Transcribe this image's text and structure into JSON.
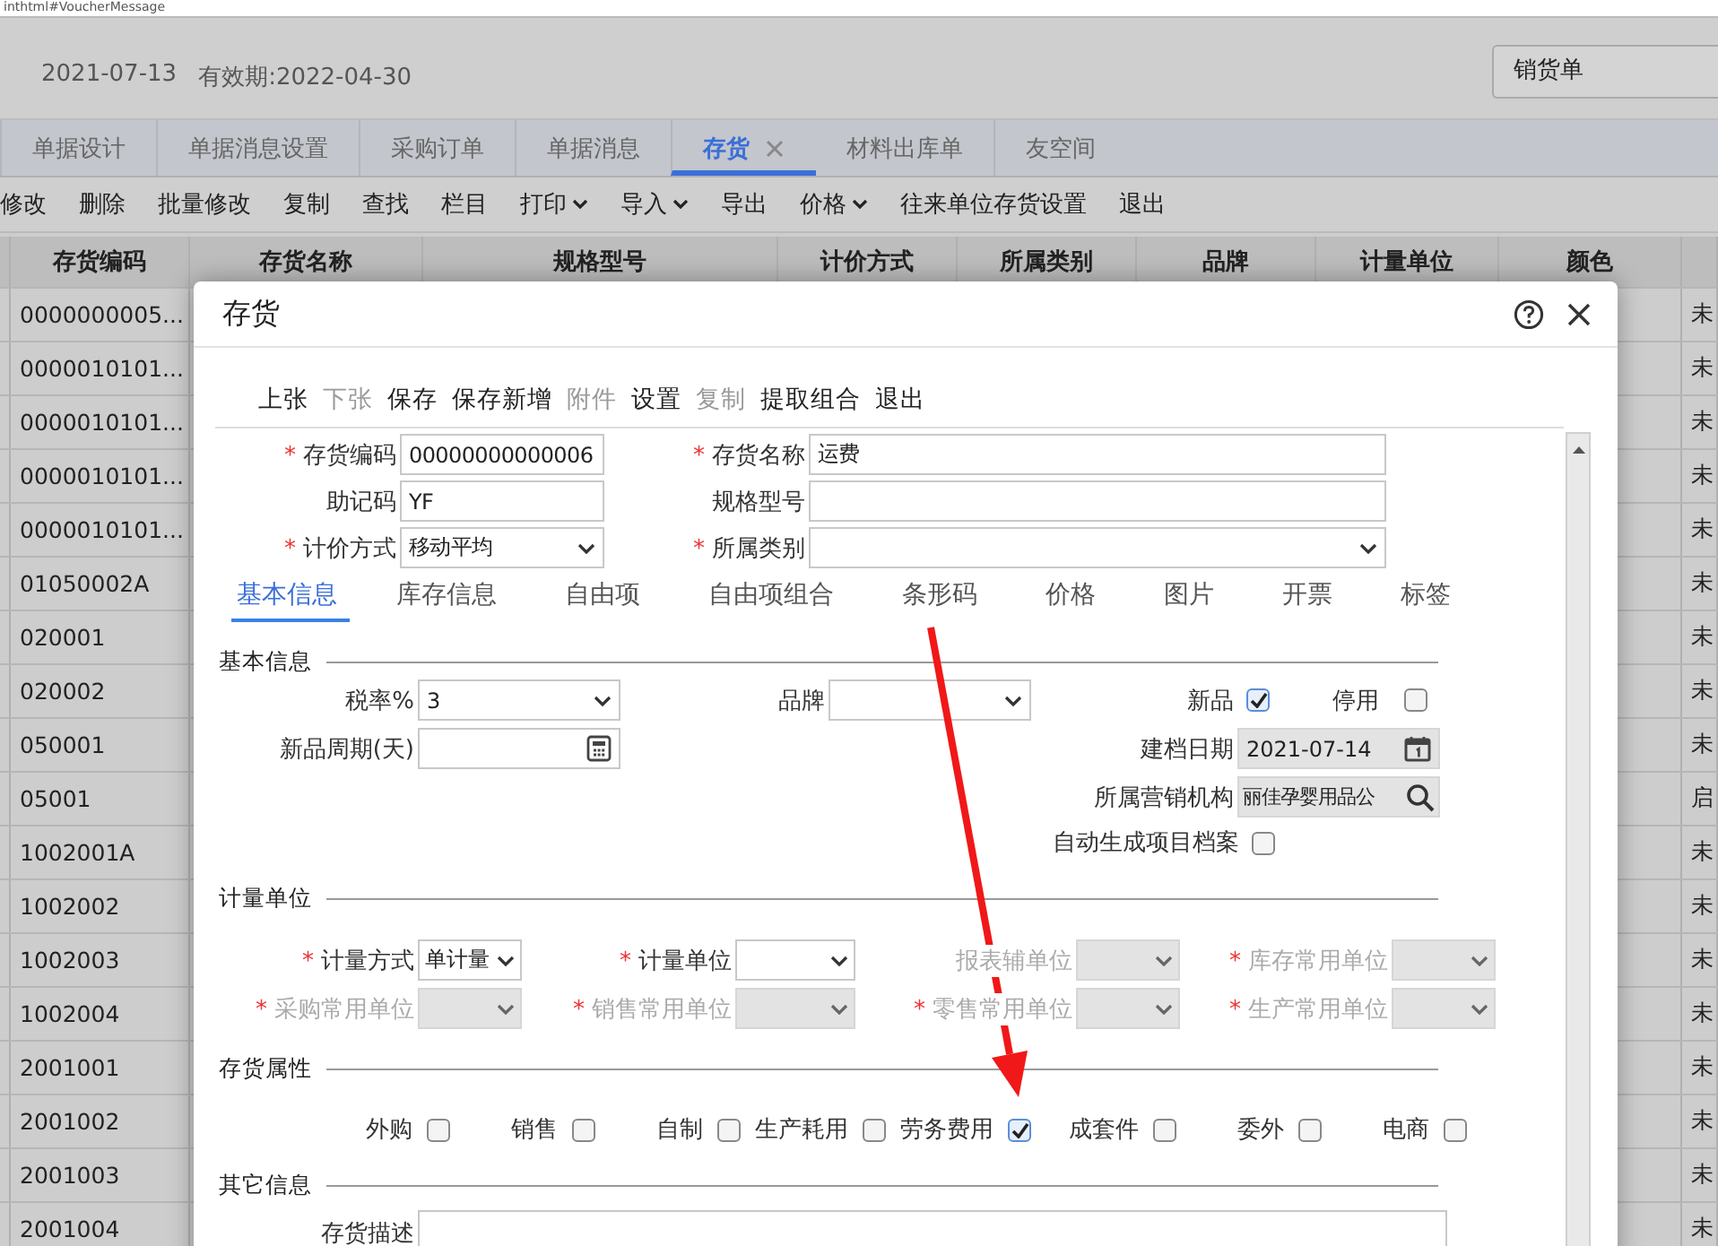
{
  "address_bar": {
    "text": "inthtml#VoucherMessage"
  },
  "header": {
    "date": "2021-07-13",
    "validity": "有效期:2022-04-30",
    "document_type": "销货单"
  },
  "tabs": [
    {
      "label": "单据设计",
      "selected": false
    },
    {
      "label": "单据消息设置",
      "selected": false
    },
    {
      "label": "采购订单",
      "selected": false
    },
    {
      "label": "单据消息",
      "selected": false
    },
    {
      "label": "存货",
      "selected": true
    },
    {
      "label": "材料出库单",
      "selected": false
    },
    {
      "label": "友空间",
      "selected": false
    }
  ],
  "toolbar": [
    {
      "label": "修改",
      "dropdown": false
    },
    {
      "label": "删除",
      "dropdown": false
    },
    {
      "label": "批量修改",
      "dropdown": false
    },
    {
      "label": "复制",
      "dropdown": false
    },
    {
      "label": "查找",
      "dropdown": false
    },
    {
      "label": "栏目",
      "dropdown": false
    },
    {
      "label": "打印",
      "dropdown": true
    },
    {
      "label": "导入",
      "dropdown": true
    },
    {
      "label": "导出",
      "dropdown": false
    },
    {
      "label": "价格",
      "dropdown": true
    },
    {
      "label": "往来单位存货设置",
      "dropdown": false
    },
    {
      "label": "退出",
      "dropdown": false
    }
  ],
  "table": {
    "columns": [
      "存货编码",
      "存货名称",
      "规格型号",
      "计价方式",
      "所属类别",
      "品牌",
      "计量单位",
      "颜色"
    ],
    "rows": [
      {
        "code": "0000000005...",
        "column_10": "未"
      },
      {
        "code": "0000010101...",
        "column_10": "未"
      },
      {
        "code": "0000010101...",
        "column_10": "未"
      },
      {
        "code": "0000010101...",
        "column_10": "未"
      },
      {
        "code": "0000010101...",
        "column_10": "未"
      },
      {
        "code": "01050002A",
        "column_10": "未"
      },
      {
        "code": "020001",
        "column_10": "未"
      },
      {
        "code": "020002",
        "column_10": "未"
      },
      {
        "code": "050001",
        "column_10": "未"
      },
      {
        "code": "05001",
        "column_10": "启"
      },
      {
        "code": "1002001A",
        "column_10": "未"
      },
      {
        "code": "1002002",
        "column_10": "未"
      },
      {
        "code": "1002003",
        "column_10": "未"
      },
      {
        "code": "1002004",
        "column_10": "未"
      },
      {
        "code": "2001001",
        "column_10": "未"
      },
      {
        "code": "2001002",
        "column_10": "未"
      },
      {
        "code": "2001003",
        "column_10": "未"
      },
      {
        "code": "2001004",
        "column_10": "未"
      }
    ]
  },
  "dialog": {
    "title": "存货",
    "toolbar": [
      {
        "label": "上张",
        "disabled": false
      },
      {
        "label": "下张",
        "disabled": true
      },
      {
        "label": "保存",
        "disabled": false
      },
      {
        "label": "保存新增",
        "disabled": false
      },
      {
        "label": "附件",
        "disabled": true
      },
      {
        "label": "设置",
        "disabled": false
      },
      {
        "label": "复制",
        "disabled": true
      },
      {
        "label": "提取组合",
        "disabled": false
      },
      {
        "label": "退出",
        "disabled": false
      }
    ],
    "header_fields": [
      {
        "label": "存货编码",
        "required_mark": "*",
        "kind": "text",
        "value": "00000000000006"
      },
      {
        "label": "存货名称",
        "required_mark": "*",
        "kind": "text",
        "value": "运费"
      },
      {
        "label": "助记码",
        "kind": "text",
        "value": "YF"
      },
      {
        "label": "规格型号",
        "kind": "text"
      },
      {
        "label": "计价方式",
        "required_mark": "*",
        "kind": "select",
        "value": "移动平均"
      },
      {
        "label": "所属类别",
        "required_mark": "*",
        "kind": "select"
      }
    ],
    "section_tabs": [
      {
        "label": "基本信息",
        "selected": true
      },
      {
        "label": "库存信息",
        "selected": false
      },
      {
        "label": "自由项",
        "selected": false
      },
      {
        "label": "自由项组合",
        "selected": false
      },
      {
        "label": "条形码",
        "selected": false
      },
      {
        "label": "价格",
        "selected": false
      },
      {
        "label": "图片",
        "selected": false
      },
      {
        "label": "开票",
        "selected": false
      },
      {
        "label": "标签",
        "selected": false
      }
    ],
    "basic_info": {
      "title": "基本信息",
      "tax_rate": {
        "label": "税率%",
        "value": "3"
      },
      "brand": {
        "label": "品牌"
      },
      "new_item": {
        "label": "新品",
        "checked": true
      },
      "inactive": {
        "label": "停用",
        "checked": false
      },
      "new_cycle": {
        "label": "新品周期(天)"
      },
      "created_date": {
        "label": "建档日期",
        "value": "2021-07-14"
      },
      "sales_org": {
        "label": "所属营销机构",
        "value": "丽佳孕婴用品公"
      },
      "auto_project": {
        "label": "自动生成项目档案",
        "checked": false
      }
    },
    "units": {
      "title": "计量单位",
      "fields": [
        {
          "label": "计量方式",
          "required_mark": "*",
          "disabled": false,
          "value": "单计量"
        },
        {
          "label": "计量单位",
          "required_mark": "*",
          "disabled": false
        },
        {
          "label": "报表辅单位",
          "disabled": true
        },
        {
          "label": "库存常用单位",
          "required_mark": "*",
          "disabled": true
        },
        {
          "label": "采购常用单位",
          "required_mark": "*",
          "disabled": true
        },
        {
          "label": "销售常用单位",
          "required_mark": "*",
          "disabled": true
        },
        {
          "label": "零售常用单位",
          "required_mark": "*",
          "disabled": true
        },
        {
          "label": "生产常用单位",
          "required_mark": "*",
          "disabled": true
        }
      ]
    },
    "attributes": {
      "title": "存货属性",
      "items": [
        {
          "label": "外购",
          "checked": false
        },
        {
          "label": "销售",
          "checked": false
        },
        {
          "label": "自制",
          "checked": false
        },
        {
          "label": "生产耗用",
          "checked": false
        },
        {
          "label": "劳务费用",
          "checked": true
        },
        {
          "label": "成套件",
          "checked": false
        },
        {
          "label": "委外",
          "checked": false
        },
        {
          "label": "电商",
          "checked": false
        }
      ]
    },
    "other_info": {
      "title": "其它信息",
      "description": {
        "label": "存货描述"
      }
    }
  }
}
